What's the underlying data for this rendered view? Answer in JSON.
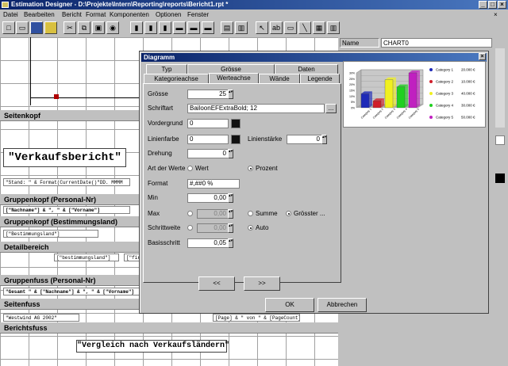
{
  "window": {
    "title": "Estimation Designer - D:\\Projekte\\Intern\\Reporting\\reports\\Bericht1.rpt *"
  },
  "menu": [
    "Datei",
    "Bearbeiten",
    "Bericht",
    "Format",
    "Komponenten",
    "Optionen",
    "Fenster"
  ],
  "design": {
    "bands": {
      "seitenkopf": "Seitenkopf",
      "gk_personal": "Gruppenkopf (Personal-Nr)",
      "gk_land": "Gruppenkopf (Bestimmungsland)",
      "detail": "Detailbereich",
      "gf_personal": "Gruppenfuss (Personal-Nr)",
      "seitenfuss": "Seitenfuss",
      "berichtsfuss": "Berichtsfuss"
    },
    "fields": {
      "verkaufsbericht": "\"Verkaufsbericht\"",
      "stand": "\"Stand: \" & Format(CurrentDate()\"DD. MMMM",
      "nachname": "[\"Nachname\"] & \", \" & [\"Vorname\"]",
      "bestimmungsland1": "[\"Bestimmungsland\"]",
      "bestimmungsland2": "[\"bestimmungsland\"]",
      "firma": "[\"firm",
      "gesamt": "\"Gesamt \" & [\"Nachname\"] & \", \" & [\"Vorname\"]",
      "westwind": "\"Westwind AG 2002\"",
      "page": "[Page] & \" von \" & [PageCount]",
      "vergleich": "\"Vergleich nach Verkaufsländern\""
    }
  },
  "props": {
    "name_label": "Name",
    "name_value": "CHART0"
  },
  "dialog": {
    "title": "Diagramm",
    "tabs_row1": [
      "Typ",
      "Grösse",
      "Daten"
    ],
    "tabs_row2": [
      "Kategorieachse",
      "Werteachse",
      "Wände",
      "Legende"
    ],
    "active_tab": "Werteachse",
    "labels": {
      "groesse": "Grösse",
      "schriftart": "Schriftart",
      "vordergrund": "Vordergrund",
      "linienfarbe": "Linienfarbe",
      "linienstaerke": "Linienstärke",
      "drehung": "Drehung",
      "artderwerte": "Art der Werte",
      "format": "Format",
      "min": "Min",
      "max": "Max",
      "schrittweite": "Schrittweite",
      "basisschritt": "Basisschritt"
    },
    "values": {
      "groesse": "25",
      "schriftart": "BailoonEFExtraBold; 12",
      "vordergrund": "0",
      "linienfarbe": "0",
      "linienstaerke": "0",
      "drehung": "0",
      "format": "#,##0 %",
      "min": "0,00",
      "max": "0,00",
      "schrittweite": "0,00",
      "basisschritt": "0,05"
    },
    "radios": {
      "wert": "Wert",
      "prozent": "Prozent",
      "summe": "Summe",
      "groesster": "Grösster ...",
      "auto": "Auto"
    },
    "buttons": {
      "prev": "<<",
      "next": ">>",
      "ok": "OK",
      "abbrechen": "Abbrechen",
      "font_browse": "..."
    }
  },
  "chart_data": {
    "type": "bar",
    "categories": [
      "Category 1",
      "Category 2",
      "Category 3",
      "Category 4",
      "Category 5"
    ],
    "values": [
      20,
      10,
      40,
      30,
      50
    ],
    "value_labels": [
      "20.000 €",
      "10.000 €",
      "40.000 €",
      "30.000 €",
      "50.000 €"
    ],
    "colors": [
      "#1e2ab8",
      "#d01e2a",
      "#f0f020",
      "#20d020",
      "#c020c0"
    ],
    "yticks": [
      "0%",
      "5%",
      "10%",
      "15%",
      "20%",
      "25%",
      "30%"
    ],
    "ylim": [
      0,
      50
    ],
    "legend": "right"
  }
}
